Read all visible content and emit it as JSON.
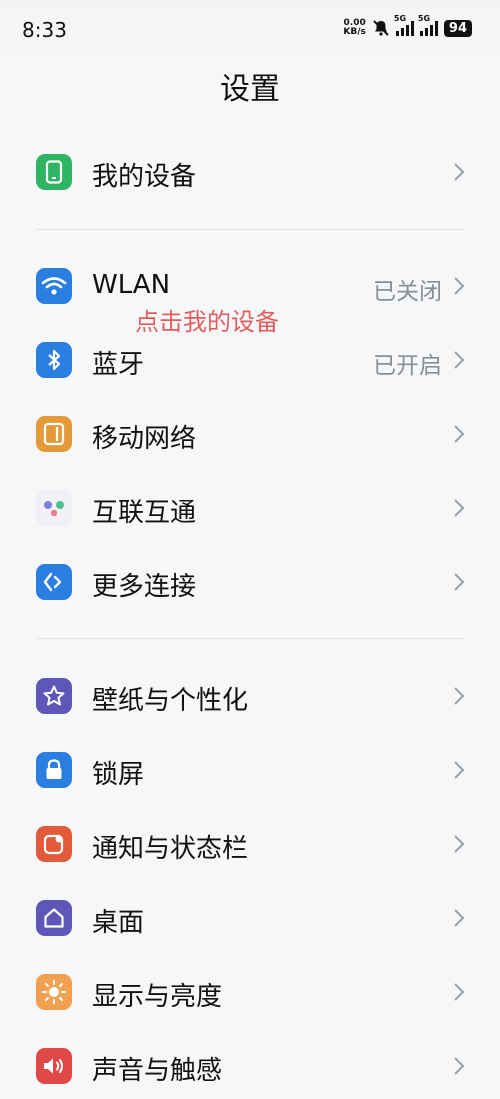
{
  "status_bar": {
    "time": "8:33",
    "net_speed_value": "0.00",
    "net_speed_unit": "KB/s",
    "signal1_label": "5G",
    "signal2_label": "5G",
    "battery": "94"
  },
  "header": {
    "title": "设置"
  },
  "annotation": "点击我的设备",
  "groups": [
    {
      "items": [
        {
          "label": "我的设备",
          "icon": "phone-icon",
          "color": "#2fb463"
        }
      ]
    },
    {
      "items": [
        {
          "label": "WLAN",
          "value": "已关闭",
          "icon": "wifi-icon",
          "color": "#2a7de1"
        },
        {
          "label": "蓝牙",
          "value": "已开启",
          "icon": "bluetooth-icon",
          "color": "#2a7de1"
        },
        {
          "label": "移动网络",
          "icon": "sim-icon",
          "color": "#e59a39"
        },
        {
          "label": "互联互通",
          "icon": "dots-icon",
          "color": "#f0f1f4"
        },
        {
          "label": "更多连接",
          "icon": "link-icon",
          "color": "#2a7de1"
        }
      ]
    },
    {
      "items": [
        {
          "label": "壁纸与个性化",
          "icon": "star-icon",
          "color": "#5e56b8"
        },
        {
          "label": "锁屏",
          "icon": "lock-icon",
          "color": "#2a7de1"
        },
        {
          "label": "通知与状态栏",
          "icon": "notification-icon",
          "color": "#e25a3a"
        },
        {
          "label": "桌面",
          "icon": "home-icon",
          "color": "#5e56b8"
        },
        {
          "label": "显示与亮度",
          "icon": "sun-icon",
          "color": "#f0a050"
        },
        {
          "label": "声音与触感",
          "icon": "speaker-icon",
          "color": "#e04747"
        }
      ]
    }
  ]
}
